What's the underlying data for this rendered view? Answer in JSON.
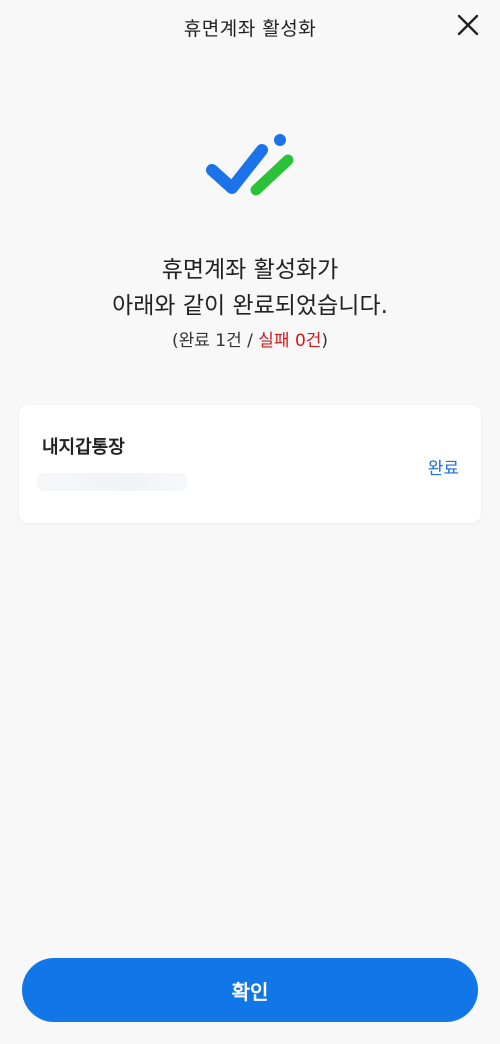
{
  "header": {
    "title": "휴면계좌 활성화"
  },
  "icons": {
    "close": "close-icon",
    "logo": "double-check-icon"
  },
  "colors": {
    "primary": "#1177e8",
    "logo_blue": "#1a73e8",
    "logo_green": "#2bc23a",
    "fail": "#d0191d",
    "status": "#1a6fd8"
  },
  "result": {
    "headline_line1": "휴면계좌 활성화가",
    "headline_line2": "아래와 같이 완료되었습니다.",
    "summary_open": "(",
    "summary_success": "완료 1건",
    "summary_sep": " / ",
    "summary_fail": "실패 0건",
    "summary_close": ")"
  },
  "account": {
    "name": "내지갑통장",
    "status": "완료"
  },
  "footer": {
    "confirm_label": "확인"
  }
}
